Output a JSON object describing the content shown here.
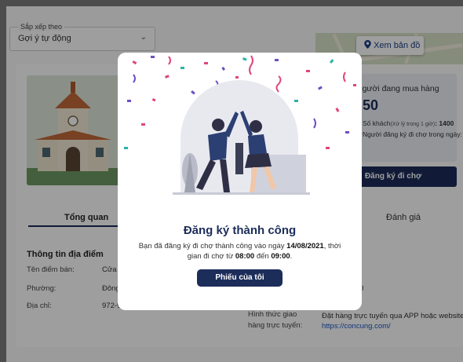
{
  "sort": {
    "label": "Sắp xếp theo",
    "value": "Gợi ý tự động"
  },
  "map_button": {
    "label": "Xem bản đồ"
  },
  "stats": {
    "title": "Người đang mua hàng",
    "count": "50",
    "line1_prefix": "Số khách",
    "line1_note": "(Xử lý trong 1 giờ)",
    "line1_value": ": 1400",
    "line2": "Người đăng ký đi chợ trong ngày:"
  },
  "register_button": {
    "label": "Đăng ký đi chợ"
  },
  "tabs": [
    "Tổng quan",
    "Đánh giá"
  ],
  "info": {
    "heading": "Thông tin địa điểm",
    "rows": [
      {
        "label": "Tên điểm bán:",
        "value": "Cửa h"
      },
      {
        "label": "Phường:",
        "value": "Đông"
      },
      {
        "label": "Địa chỉ:",
        "value": "972-9"
      }
    ],
    "right_partial": "0",
    "online_label_1": "Hình thức giao",
    "online_label_2": "hàng trực tuyến:",
    "online_value": "Đặt hàng trực tuyến qua APP hoặc website",
    "online_link": "https://concung.com/"
  },
  "modal": {
    "title": "Đăng ký thành công",
    "body_before": "Bạn đã đăng ký đi chợ thành công vào ngày ",
    "date": "14/08/2021",
    "body_middle": ", thời gian đi chợ từ ",
    "time_from": "08:00",
    "body_to": " đến ",
    "time_to": "09:00",
    "body_end": ".",
    "button": "Phiếu của tôi"
  },
  "colors": {
    "primary": "#1c2d5a",
    "link": "#1a56c4",
    "accent_pink": "#e0457b"
  }
}
